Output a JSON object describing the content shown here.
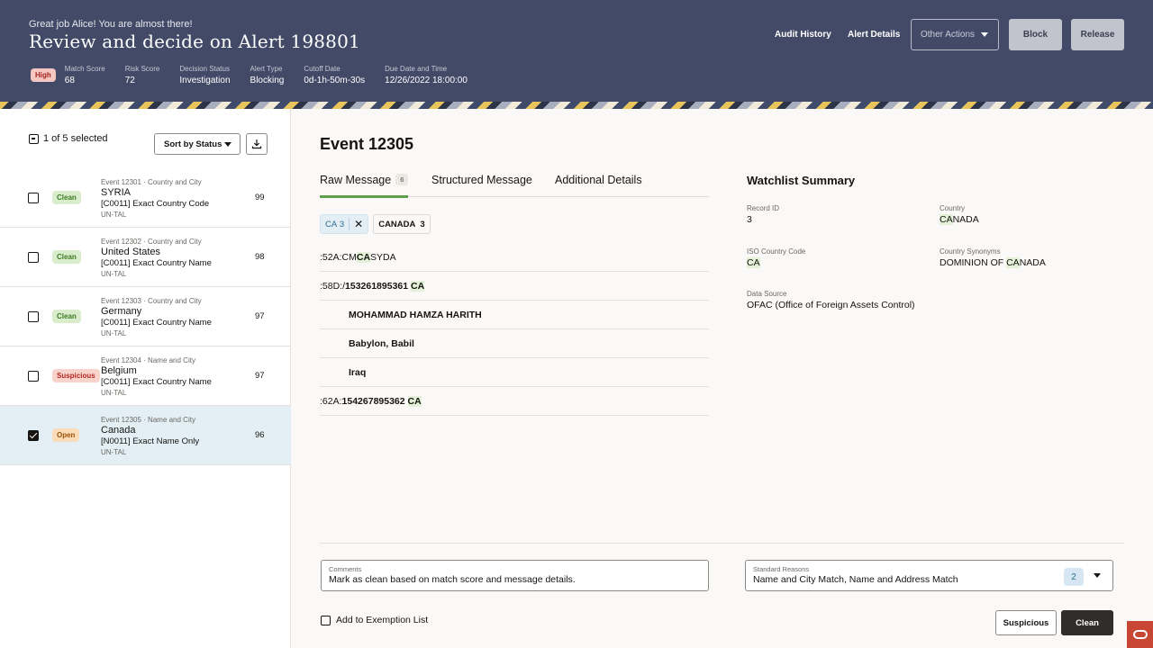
{
  "header": {
    "greeting": "Great job Alice! You are almost there!",
    "title": "Review and decide on Alert 198801",
    "severity": "High",
    "meta": [
      {
        "label": "Match Score",
        "value": "68"
      },
      {
        "label": "Risk Score",
        "value": "72"
      },
      {
        "label": "Decision Status",
        "value": "Investigation"
      },
      {
        "label": "Alert Type",
        "value": "Blocking"
      },
      {
        "label": "Cutoff Date",
        "value": "0d-1h-50m-30s"
      },
      {
        "label": "Due Date and Time",
        "value": "12/26/2022 18:00:00"
      }
    ],
    "audit_history": "Audit History",
    "alert_details": "Alert Details",
    "other_actions": "Other Actions",
    "block": "Block",
    "release": "Release"
  },
  "sidebar": {
    "selection": "1 of 5 selected",
    "sort_label": "Sort by Status",
    "items": [
      {
        "status": "Clean",
        "event": "Event 12301",
        "category": "Country and City",
        "country": "SYRIA",
        "rule": "[C0011] Exact Country Code",
        "list": "UN-TAL",
        "score": "99",
        "checked": false
      },
      {
        "status": "Clean",
        "event": "Event 12302",
        "category": "Country and City",
        "country": "United States",
        "rule": "[C0011] Exact Country Name",
        "list": "UN-TAL",
        "score": "98",
        "checked": false
      },
      {
        "status": "Clean",
        "event": "Event 12303",
        "category": "Country and City",
        "country": "Germany",
        "rule": "[C0011] Exact Country Name",
        "list": "UN-TAL",
        "score": "97",
        "checked": false
      },
      {
        "status": "Suspicious",
        "event": "Event 12304",
        "category": "Name and City",
        "country": "Belgium",
        "rule": "[C0011] Exact Country Name",
        "list": "UN-TAL",
        "score": "97",
        "checked": false
      },
      {
        "status": "Open",
        "event": "Event 12305",
        "category": "Name and City",
        "country": "Canada",
        "rule": "[N0011] Exact Name Only",
        "list": "UN-TAL",
        "score": "96",
        "checked": true
      }
    ]
  },
  "main": {
    "event_title": "Event 12305",
    "tabs": [
      {
        "label": "Raw Message",
        "count": "6"
      },
      {
        "label": "Structured Message"
      },
      {
        "label": "Additional Details"
      }
    ],
    "chips": [
      {
        "label": "CA",
        "count": "3"
      },
      {
        "label": "CANADA",
        "count": "3"
      }
    ],
    "message": {
      "l1_prefix": ":52A:CM",
      "l1_hl": "CA",
      "l1_suffix": "SYDA",
      "l2_prefix": ":58D:/",
      "l2_num": "153261895361",
      "l2_hl": "CA",
      "name": "MOHAMMAD HAMZA HARITH",
      "city": "Babylon, Babil",
      "country": "Iraq",
      "l6_prefix": ":62A:",
      "l6_num": "154267895362",
      "l6_hl": "CA"
    },
    "watchlist": {
      "title": "Watchlist Summary",
      "record_id_label": "Record ID",
      "record_id": "3",
      "country_label": "Country",
      "country_hl": "CA",
      "country_rest": "NADA",
      "iso_label": "ISO Country Code",
      "iso": "CA",
      "synonyms_label": "Country Synonyms",
      "synonyms_prefix": "DOMINION OF ",
      "synonyms_hl": "CA",
      "synonyms_rest": "NADA",
      "source_label": "Data Source",
      "source": "OFAC (Office of Foreign Assets Control)"
    },
    "comments": {
      "label": "Comments",
      "value": "Mark as clean based on match score and message details."
    },
    "reasons": {
      "label": "Standard Reasons",
      "value": "Name and City Match, Name and Address Match",
      "count": "2"
    },
    "exemption": "Add to Exemption List",
    "suspicious_button": "Suspicious",
    "clean_button": "Clean"
  },
  "colors": {
    "header_bg": "#434a67",
    "accent_green": "#5e9f48",
    "selected_row": "#e3eef5",
    "oracle_red": "#c74634"
  }
}
